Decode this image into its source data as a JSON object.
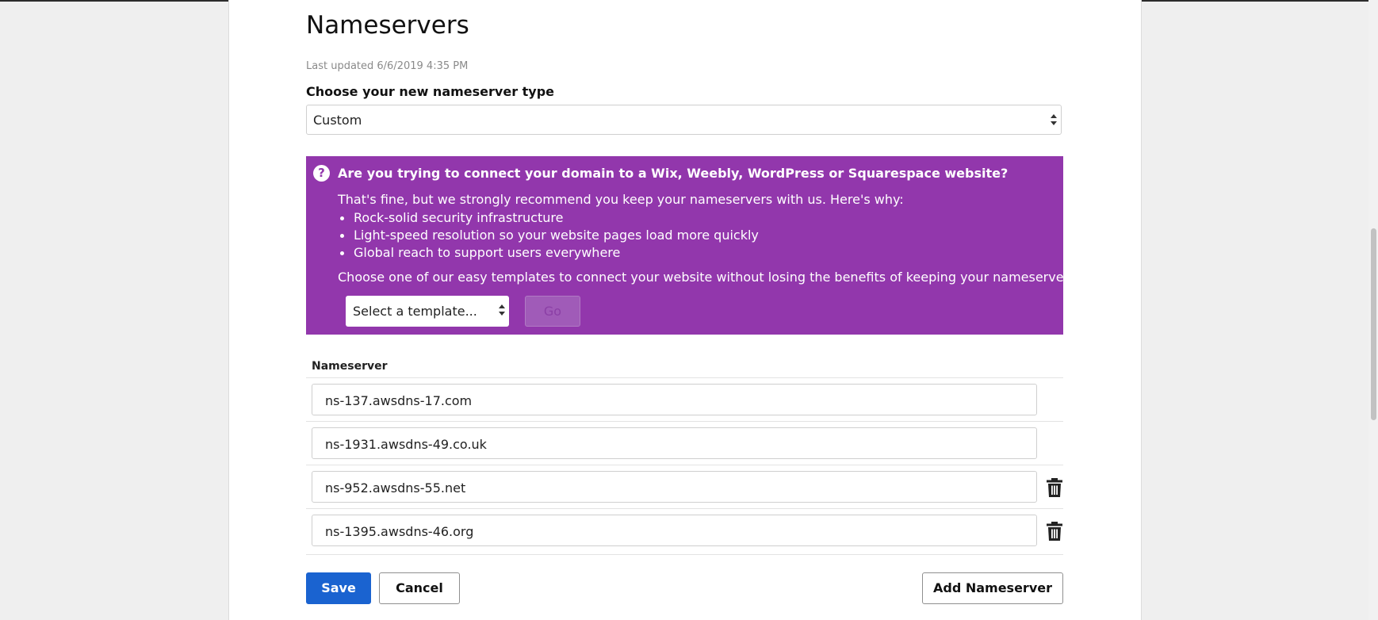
{
  "page": {
    "title": "Nameservers",
    "last_updated": "Last updated 6/6/2019 4:35 PM"
  },
  "nameserver_type": {
    "label": "Choose your new nameserver type",
    "selected": "Custom"
  },
  "promo": {
    "icon": "question-circle-icon",
    "title": "Are you trying to connect your domain to a Wix, Weebly, WordPress or Squarespace website?",
    "intro": "That's fine, but we strongly recommend you keep your nameservers with us. Here's why:",
    "reasons": [
      "Rock-solid security infrastructure",
      "Light-speed resolution so your website pages load more quickly",
      "Global reach to support users everywhere"
    ],
    "choose_text": "Choose one of our easy templates to connect your website without losing the benefits of keeping your nameservers.",
    "template_select": {
      "selected": "Select a template..."
    },
    "go_label": "Go",
    "background_color": "#9237ac"
  },
  "nameservers": {
    "header": "Nameserver",
    "rows": [
      {
        "value": "ns-137.awsdns-17.com",
        "deletable": false
      },
      {
        "value": "ns-1931.awsdns-49.co.uk",
        "deletable": false
      },
      {
        "value": "ns-952.awsdns-55.net",
        "deletable": true,
        "icon": "trash-icon"
      },
      {
        "value": "ns-1395.awsdns-46.org",
        "deletable": true,
        "icon": "trash-icon"
      }
    ]
  },
  "actions": {
    "save_label": "Save",
    "cancel_label": "Cancel",
    "add_label": "Add Nameserver",
    "primary_color": "#1a63d0"
  }
}
